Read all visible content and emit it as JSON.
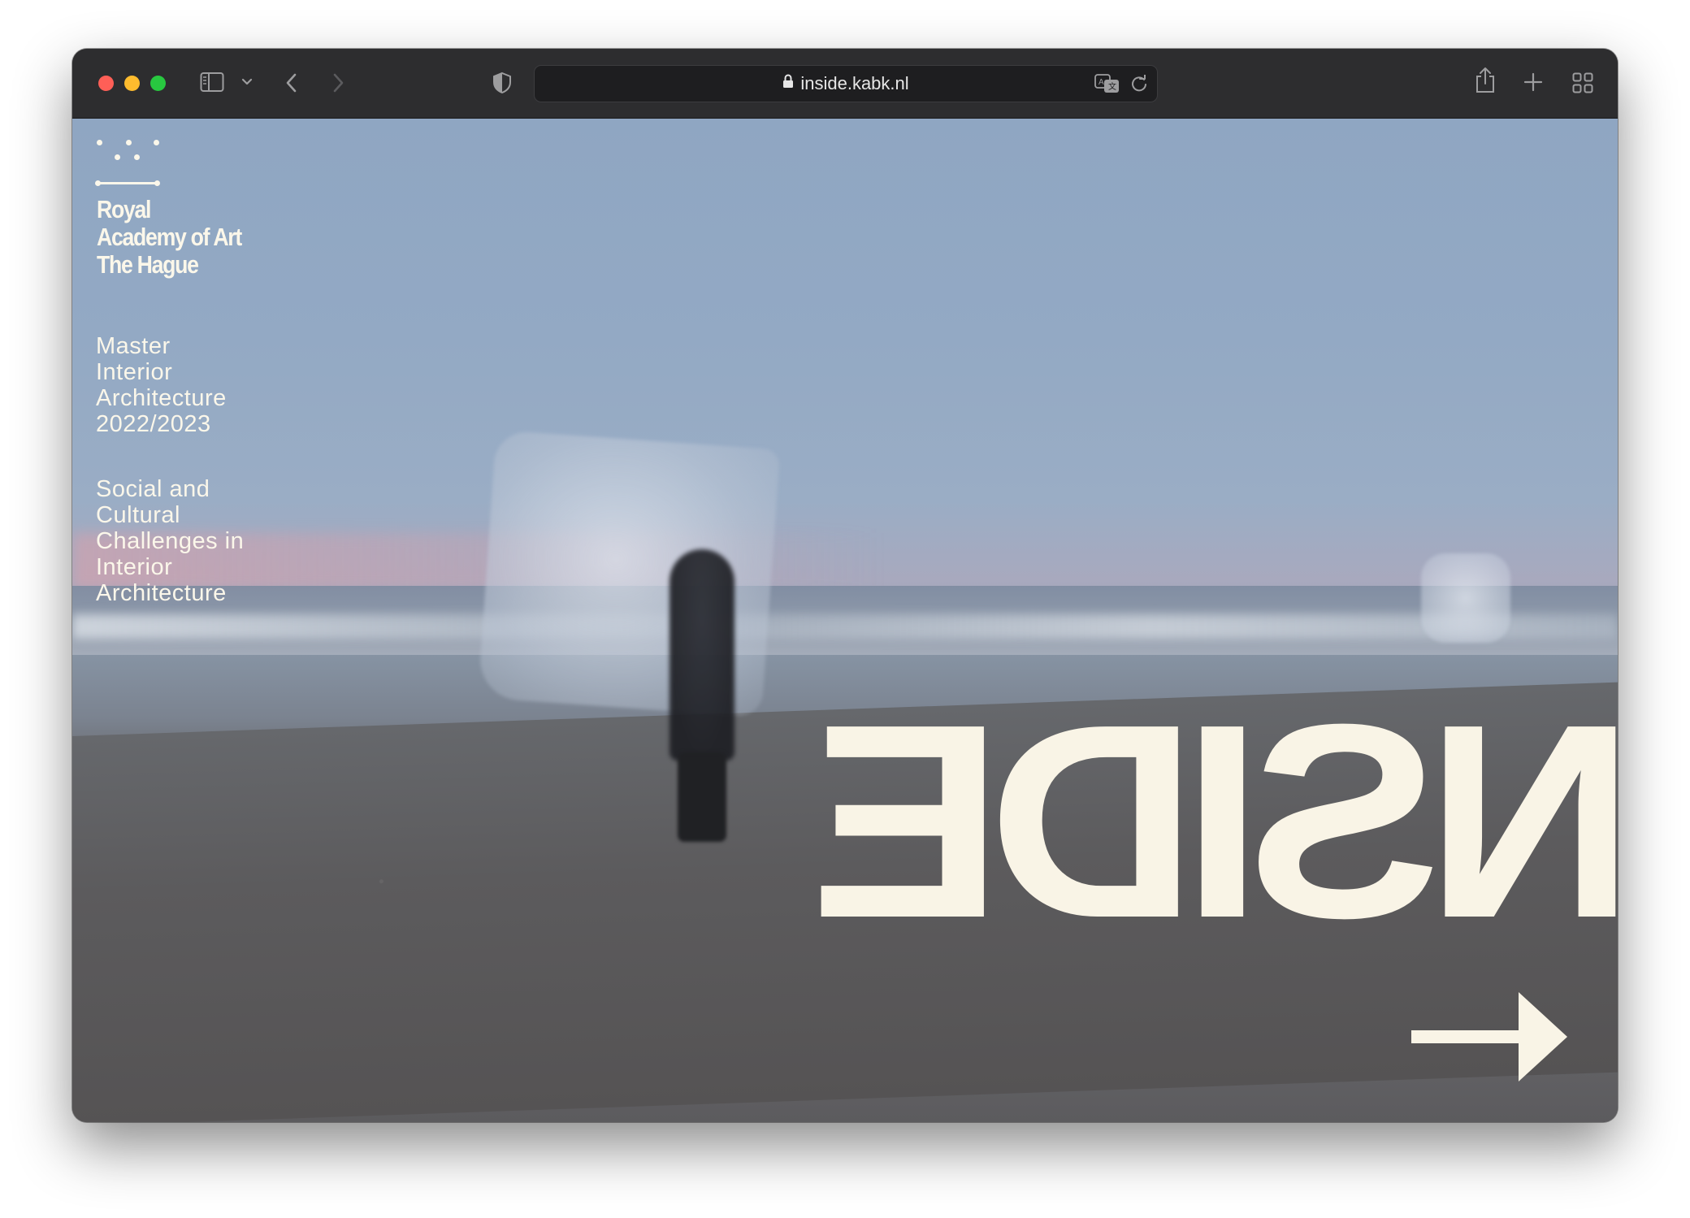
{
  "browser": {
    "url": "inside.kabk.nl",
    "icons": [
      "sidebar-icon",
      "chevron-down-icon",
      "back-icon",
      "forward-icon",
      "shield-icon",
      "lock-icon",
      "translate-icon",
      "reload-icon",
      "share-icon",
      "new-tab-icon",
      "tab-overview-icon"
    ],
    "traffic_lights": {
      "close": "#ff5f57",
      "minimize": "#febc2e",
      "zoom": "#28c840"
    }
  },
  "page": {
    "logo": {
      "line1": "Royal",
      "line2": "Academy of Art",
      "line3": "The Hague"
    },
    "program": {
      "line1": "Master",
      "line2": "Interior",
      "line3": "Architecture",
      "line4": "2022/2023"
    },
    "theme": {
      "line1": "Social and",
      "line2": "Cultural",
      "line3": "Challenges in",
      "line4": "Interior",
      "line5": "Architecture"
    },
    "hero_word": "INSIDE",
    "text_color": "#fbf7ea"
  }
}
